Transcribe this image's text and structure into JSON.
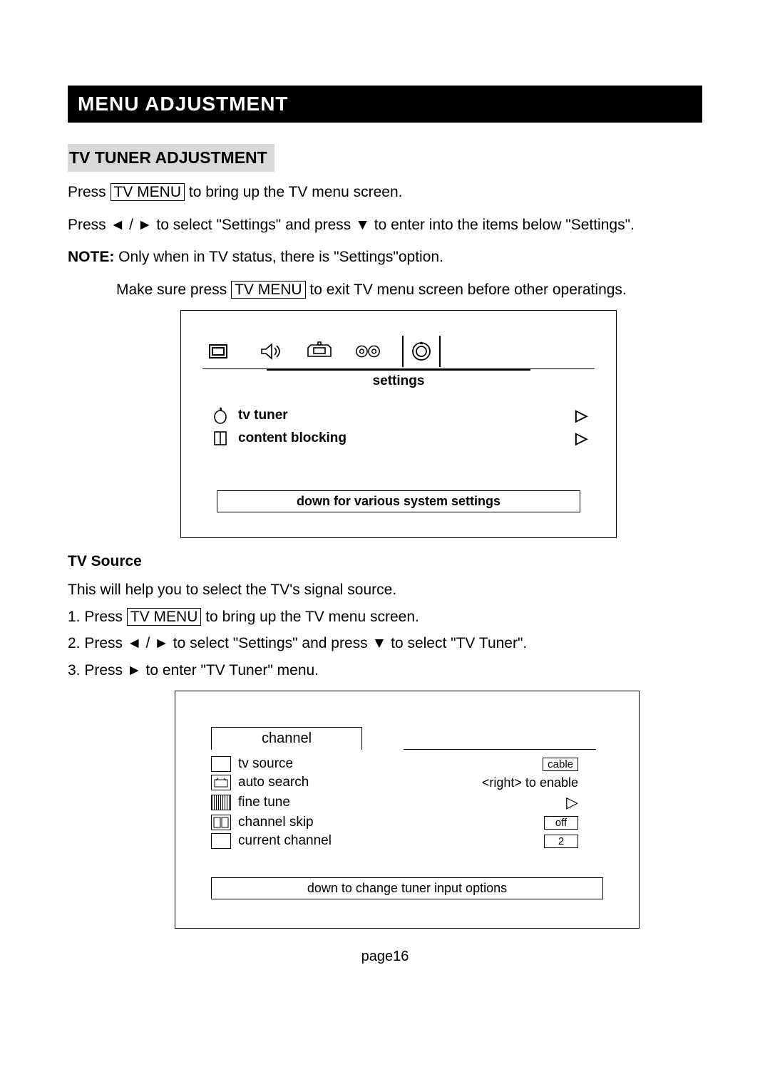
{
  "title": "MENU ADJUSTMENT",
  "section_heading": "TV TUNER ADJUSTMENT",
  "line1_a": "Press ",
  "tv_menu_btn": "TV MENU",
  "line1_b": " to bring up the TV menu screen.",
  "line2": "Press ◄ / ► to select \"Settings\" and press ▼ to enter into the items below \"Settings\".",
  "note_label": "NOTE:",
  "note_text": " Only when in TV status, there is \"Settings\"option.",
  "line3_a": "Make sure press ",
  "line3_b": " to exit TV menu screen before other operatings.",
  "menu1": {
    "tab_label": "settings",
    "items": [
      {
        "label": "tv tuner"
      },
      {
        "label": "content  blocking"
      }
    ],
    "hint": "down for various system settings"
  },
  "tv_source_heading": "TV Source",
  "tv_source_desc": "This will help you to select the TV's signal source.",
  "step1_a": "1. Press ",
  "step1_b": " to bring up the TV menu screen.",
  "step2": "2. Press  ◄ /  ► to select  \"Settings\" and press  ▼ to select \"TV Tuner\".",
  "step3": "3. Press ► to enter \"TV Tuner\" menu.",
  "menu2": {
    "tab": "channel",
    "rows": {
      "tv_source": {
        "label": "tv source",
        "value": "cable"
      },
      "auto_search": {
        "label": "auto search",
        "value": "<right> to enable"
      },
      "fine_tune": {
        "label": "fine tune"
      },
      "channel_skip": {
        "label": "channel skip",
        "value": "off"
      },
      "current_channel": {
        "label": "current channel",
        "value": "2"
      }
    },
    "hint": "down to change tuner  input options"
  },
  "page_num": "page16"
}
